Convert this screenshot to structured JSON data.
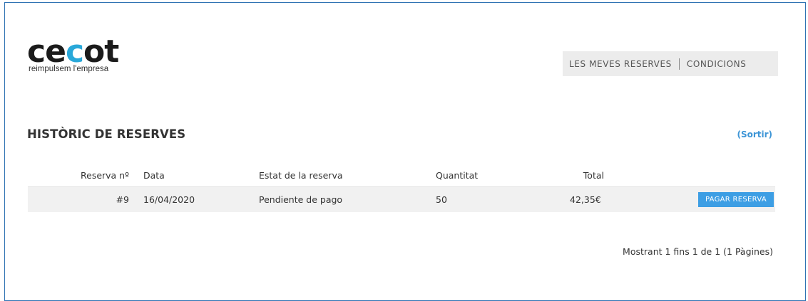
{
  "brand": {
    "logo_text_part1": "ce",
    "logo_text_accent": "c",
    "logo_text_part2": "ot",
    "tagline": "reimpulsem l'empresa",
    "accent_color": "#29a8d9"
  },
  "topnav": {
    "items": [
      {
        "label": "LES MEVES RESERVES"
      },
      {
        "label": "CONDICIONS"
      }
    ]
  },
  "page": {
    "title": "HISTÒRIC DE RESERVES",
    "logout_label": "(Sortir)"
  },
  "table": {
    "headers": {
      "number": "Reserva nº",
      "date": "Data",
      "status": "Estat de la reserva",
      "quantity": "Quantitat",
      "total": "Total"
    },
    "rows": [
      {
        "number": "#9",
        "date": "16/04/2020",
        "status": "Pendiente de pago",
        "quantity": "50",
        "total": "42,35€",
        "action_label": "PAGAR RESERVA"
      }
    ]
  },
  "pagination": {
    "info": "Mostrant 1 fins 1 de 1 (1 Pàgines)"
  },
  "colors": {
    "link": "#3d95d6",
    "button": "#3d9ee4",
    "nav_bg": "#ececec",
    "row_bg": "#f1f1f1"
  }
}
